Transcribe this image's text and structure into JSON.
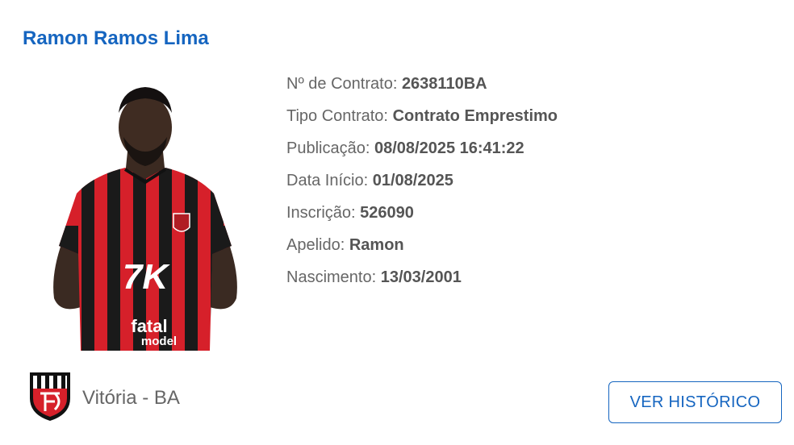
{
  "player": {
    "name": "Ramon Ramos Lima",
    "jersey_sponsor_top": "7K",
    "jersey_sponsor_bottom_line1": "fatal",
    "jersey_sponsor_bottom_line2": "model"
  },
  "details": [
    {
      "label": "Nº de Contrato:",
      "value": "2638110BA"
    },
    {
      "label": "Tipo Contrato:",
      "value": "Contrato Emprestimo"
    },
    {
      "label": "Publicação:",
      "value": "08/08/2025 16:41:22"
    },
    {
      "label": "Data Início:",
      "value": "01/08/2025"
    },
    {
      "label": "Inscrição:",
      "value": "526090"
    },
    {
      "label": "Apelido:",
      "value": "Ramon"
    },
    {
      "label": "Nascimento:",
      "value": "13/03/2001"
    }
  ],
  "club": {
    "name": "Vitória - BA",
    "crest_icon": "club-crest-icon"
  },
  "actions": {
    "history_button": "VER HISTÓRICO"
  },
  "colors": {
    "accent": "#1565c0",
    "jersey_red": "#d6202a",
    "jersey_black": "#1a1a1a",
    "label_gray": "#666666"
  }
}
